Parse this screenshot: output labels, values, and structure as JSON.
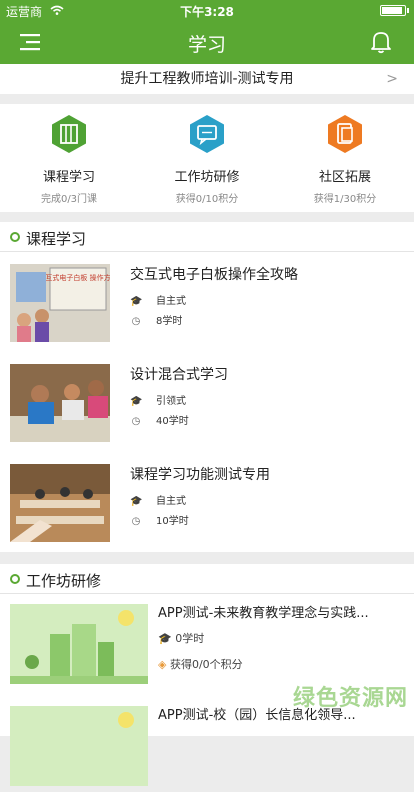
{
  "status": {
    "carrier": "运营商",
    "time": "下午3:28"
  },
  "nav": {
    "title": "学习"
  },
  "banner": {
    "text": "提升工程教师培训-测试专用"
  },
  "features": [
    {
      "name": "课程学习",
      "sub": "完成0/3门课",
      "color": "#4fa234",
      "icon": "book-icon"
    },
    {
      "name": "工作坊研修",
      "sub": "获得0/10积分",
      "color": "#2aa0c8",
      "icon": "chat-icon"
    },
    {
      "name": "社区拓展",
      "sub": "获得1/30积分",
      "color": "#ee7a22",
      "icon": "tablet-icon"
    }
  ],
  "courses_section": {
    "title": "课程学习"
  },
  "courses": [
    {
      "title": "交互式电子白板操作全攻略",
      "mode": "自主式",
      "hours": "8学时",
      "thumb_text": "交互式电子白板 操作方法"
    },
    {
      "title": "设计混合式学习",
      "mode": "引领式",
      "hours": "40学时"
    },
    {
      "title": "课程学习功能测试专用",
      "mode": "自主式",
      "hours": "10学时"
    }
  ],
  "workshop_section": {
    "title": "工作坊研修"
  },
  "workshops": [
    {
      "title": "APP测试-未来教育教学理念与实践...",
      "hours": "0学时",
      "points": "获得0/0个积分"
    },
    {
      "title": "APP测试-校（园）长信息化领导..."
    }
  ],
  "watermark": "绿色资源网"
}
